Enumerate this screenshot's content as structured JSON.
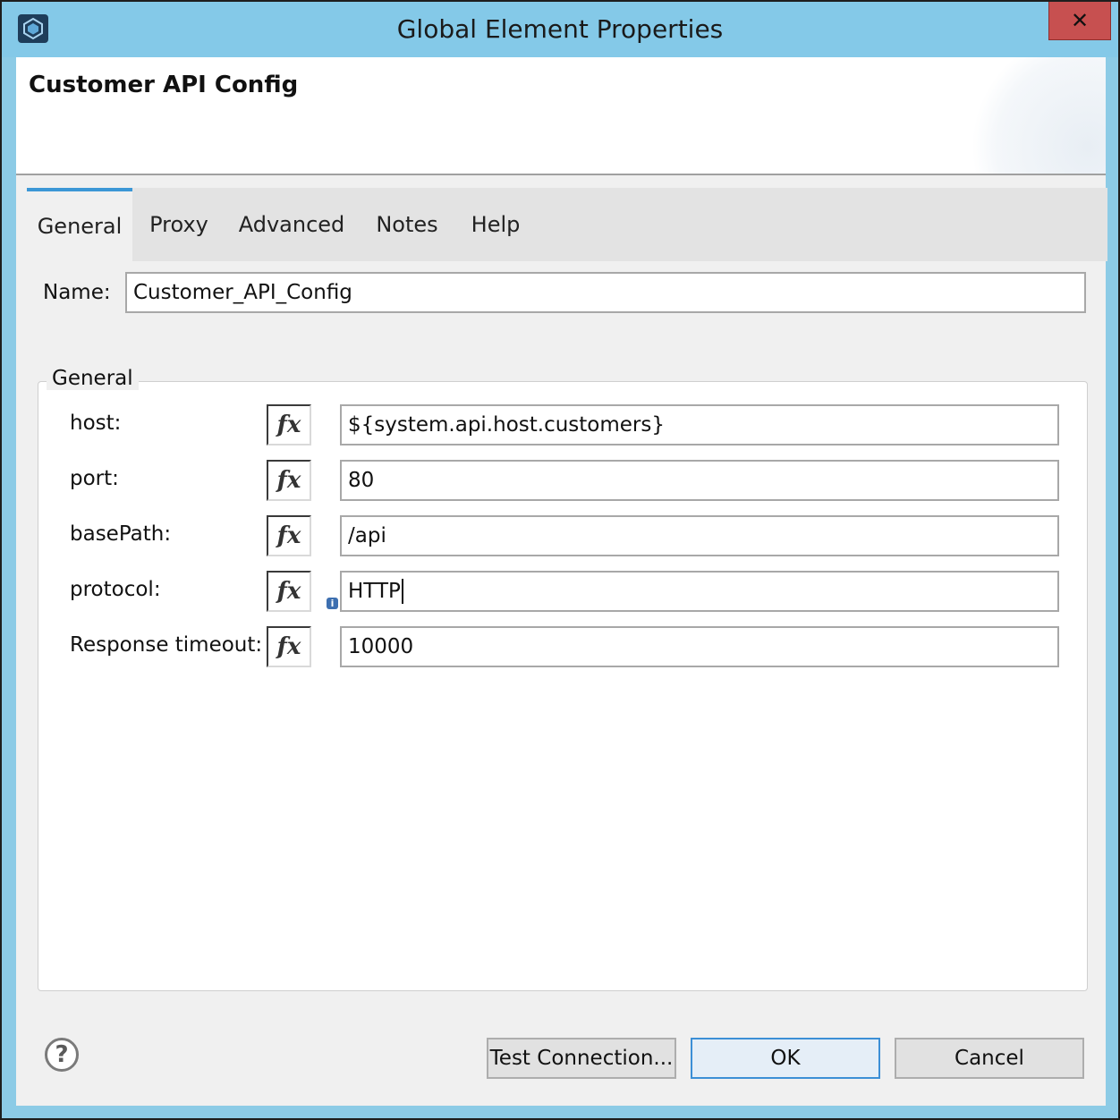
{
  "window": {
    "title": "Global Element Properties",
    "close_glyph": "✕"
  },
  "header": {
    "title": "Customer API Config"
  },
  "tabs": [
    {
      "label": "General",
      "active": true
    },
    {
      "label": "Proxy"
    },
    {
      "label": "Advanced"
    },
    {
      "label": "Notes"
    },
    {
      "label": "Help"
    }
  ],
  "name_field": {
    "label": "Name:",
    "value": "Customer_API_Config"
  },
  "general_group": {
    "legend": "General",
    "fields": [
      {
        "label": "host:",
        "value": "${system.api.host.customers}"
      },
      {
        "label": "port:",
        "value": "80"
      },
      {
        "label": "basePath:",
        "value": "/api"
      },
      {
        "label": "protocol:",
        "value": "HTTP"
      },
      {
        "label": "Response timeout:",
        "value": "10000"
      }
    ],
    "fx_label": "fx"
  },
  "buttons": {
    "test_connection": "Test Connection...",
    "ok": "OK",
    "cancel": "Cancel"
  },
  "icons": {
    "app": "app-icon",
    "help": "help-icon",
    "info": "info-icon",
    "help_glyph": "?",
    "info_glyph": "i"
  },
  "colors": {
    "titlebar": "#84c9e8",
    "close": "#c75050",
    "tab_accent": "#3c97d6",
    "default_button_border": "#3c8fd6"
  }
}
